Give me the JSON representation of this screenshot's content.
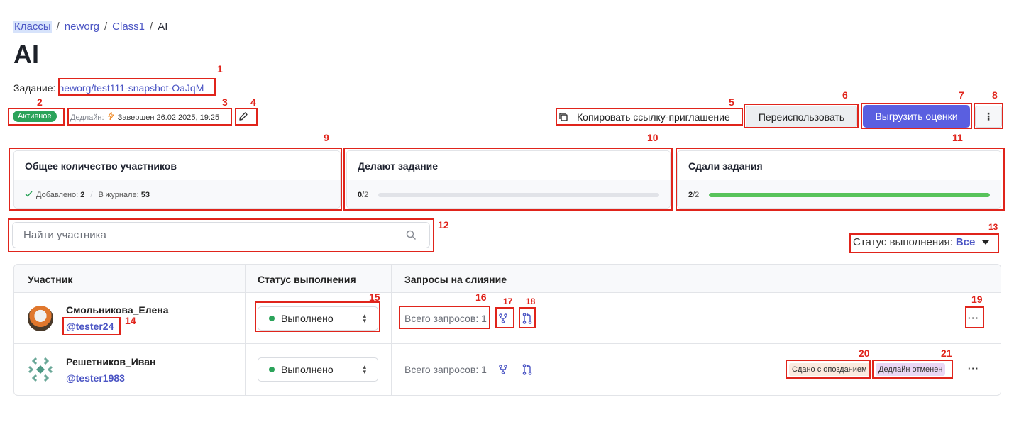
{
  "breadcrumb": {
    "items": [
      "Классы",
      "neworg",
      "Class1",
      "AI"
    ],
    "separator": "/"
  },
  "page_title": "AI",
  "assignment": {
    "label": "Задание:",
    "link": "neworg/test111-snapshot-OaJqM"
  },
  "status_badge": "Активное",
  "deadline": {
    "label": "Дедлайн:",
    "value": "Завершен 26.02.2025, 19:25"
  },
  "actions": {
    "copy_link": "Копировать ссылку-приглашение",
    "reuse": "Переиспользовать",
    "export": "Выгрузить оценки",
    "more": "⋮"
  },
  "stats": {
    "total": {
      "title": "Общее количество участников",
      "added_label": "Добавлено:",
      "added_value": "2",
      "journal_label": "В журнале:",
      "journal_value": "53"
    },
    "doing": {
      "title": "Делают задание",
      "count": "0",
      "total": "/2",
      "fraction": 0
    },
    "submitted": {
      "title": "Сдали задания",
      "count": "2",
      "total": "/2",
      "fraction": 1
    }
  },
  "search": {
    "placeholder": "Найти участника"
  },
  "status_filter": {
    "label": "Статус выполнения:",
    "value": "Все"
  },
  "table": {
    "headers": [
      "Участник",
      "Статус выполнения",
      "Запросы на слияние"
    ],
    "rows": [
      {
        "name": "Смольникова_Елена",
        "handle": "@tester24",
        "status": "Выполнено",
        "requests": "Всего запросов: 1",
        "tags": []
      },
      {
        "name": "Решетников_Иван",
        "handle": "@tester1983",
        "status": "Выполнено",
        "requests": "Всего запросов: 1",
        "tags": [
          "Сдано с опозданием",
          "Дедлайн отменен"
        ]
      }
    ]
  },
  "annotations": [
    "1",
    "2",
    "3",
    "4",
    "5",
    "6",
    "7",
    "8",
    "9",
    "10",
    "11",
    "12",
    "13",
    "14",
    "15",
    "16",
    "17",
    "18",
    "19",
    "20",
    "21"
  ],
  "colors": {
    "accent": "#5a5fe0",
    "link": "#4b55c4",
    "success": "#2ba35a",
    "progress": "#58c35a",
    "annotation": "#e0241b"
  }
}
